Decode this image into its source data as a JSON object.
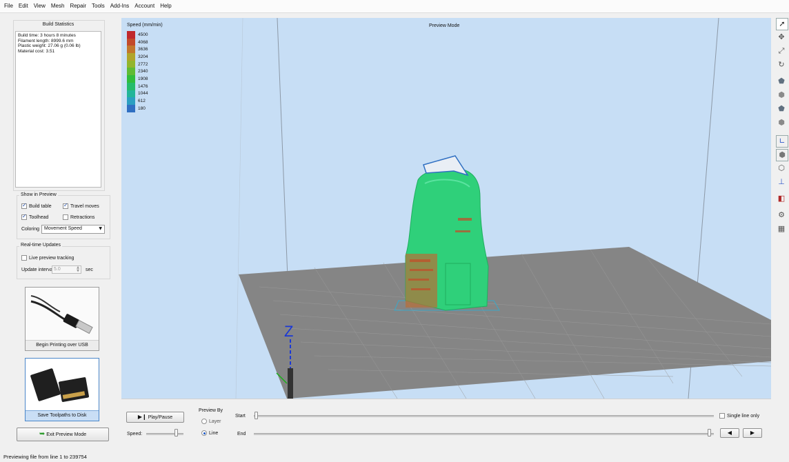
{
  "menu": [
    "File",
    "Edit",
    "View",
    "Mesh",
    "Repair",
    "Tools",
    "Add-Ins",
    "Account",
    "Help"
  ],
  "left_panel": {
    "stats_title": "Build Statistics",
    "stats_lines": [
      "Build time: 3 hours 8 minutes",
      "Filament length: 8999.6 mm",
      "Plastic weight: 27.06 g (0.06 lb)",
      "Material cost: 3.51"
    ],
    "show_in_preview": {
      "title": "Show in Preview",
      "build_table": {
        "label": "Build table",
        "checked": true
      },
      "travel_moves": {
        "label": "Travel moves",
        "checked": true
      },
      "toolhead": {
        "label": "Toolhead",
        "checked": true
      },
      "retractions": {
        "label": "Retractions",
        "checked": false
      },
      "coloring_label": "Coloring",
      "coloring_value": "Movement Speed"
    },
    "realtime": {
      "title": "Real-time Updates",
      "live_label": "Live preview tracking",
      "live_checked": false,
      "interval_label": "Update interval",
      "interval_value": "5.0",
      "interval_unit": "sec"
    },
    "usb_button": "Begin Printing over USB",
    "disk_button": "Save Toolpaths to Disk",
    "exit_button": "Exit Preview Mode"
  },
  "viewport": {
    "mode_label": "Preview Mode",
    "axis_label": "Z",
    "legend_title": "Speed (mm/min)",
    "legend": [
      {
        "value": "4500",
        "color": "#c0282c"
      },
      {
        "value": "4068",
        "color": "#c24a2a"
      },
      {
        "value": "3636",
        "color": "#c2772c"
      },
      {
        "value": "3204",
        "color": "#b0a52c"
      },
      {
        "value": "2772",
        "color": "#92b52e"
      },
      {
        "value": "2340",
        "color": "#5fbb35"
      },
      {
        "value": "1908",
        "color": "#30bd3d"
      },
      {
        "value": "1476",
        "color": "#25bc6b"
      },
      {
        "value": "1044",
        "color": "#21b59a"
      },
      {
        "value": "612",
        "color": "#2a9fc1"
      },
      {
        "value": "180",
        "color": "#2f6fc2"
      }
    ]
  },
  "bottom_panel": {
    "play_label": "Play/Pause",
    "speed_label": "Speed:",
    "speed_level": 0.82,
    "preview_by_label": "Preview By",
    "option_layer": "Layer",
    "option_line": "Line",
    "selected": "Line",
    "start_label": "Start",
    "end_label": "End",
    "single_line_label": "Single line only",
    "single_line_checked": false
  },
  "status": "Previewing file from line 1 to 239754",
  "toolbar_icons": [
    "select-arrow-icon",
    "move-icon",
    "scale-icon",
    "rotate-icon",
    "view-cube-front-icon",
    "view-cube-left-icon",
    "view-cube-top-icon",
    "view-cube-right-icon",
    "axes-view-icon",
    "solid-view-icon",
    "wireframe-view-icon",
    "drop-to-bed-icon",
    "mirror-icon",
    "settings-gear-icon",
    "build-table-icon"
  ]
}
